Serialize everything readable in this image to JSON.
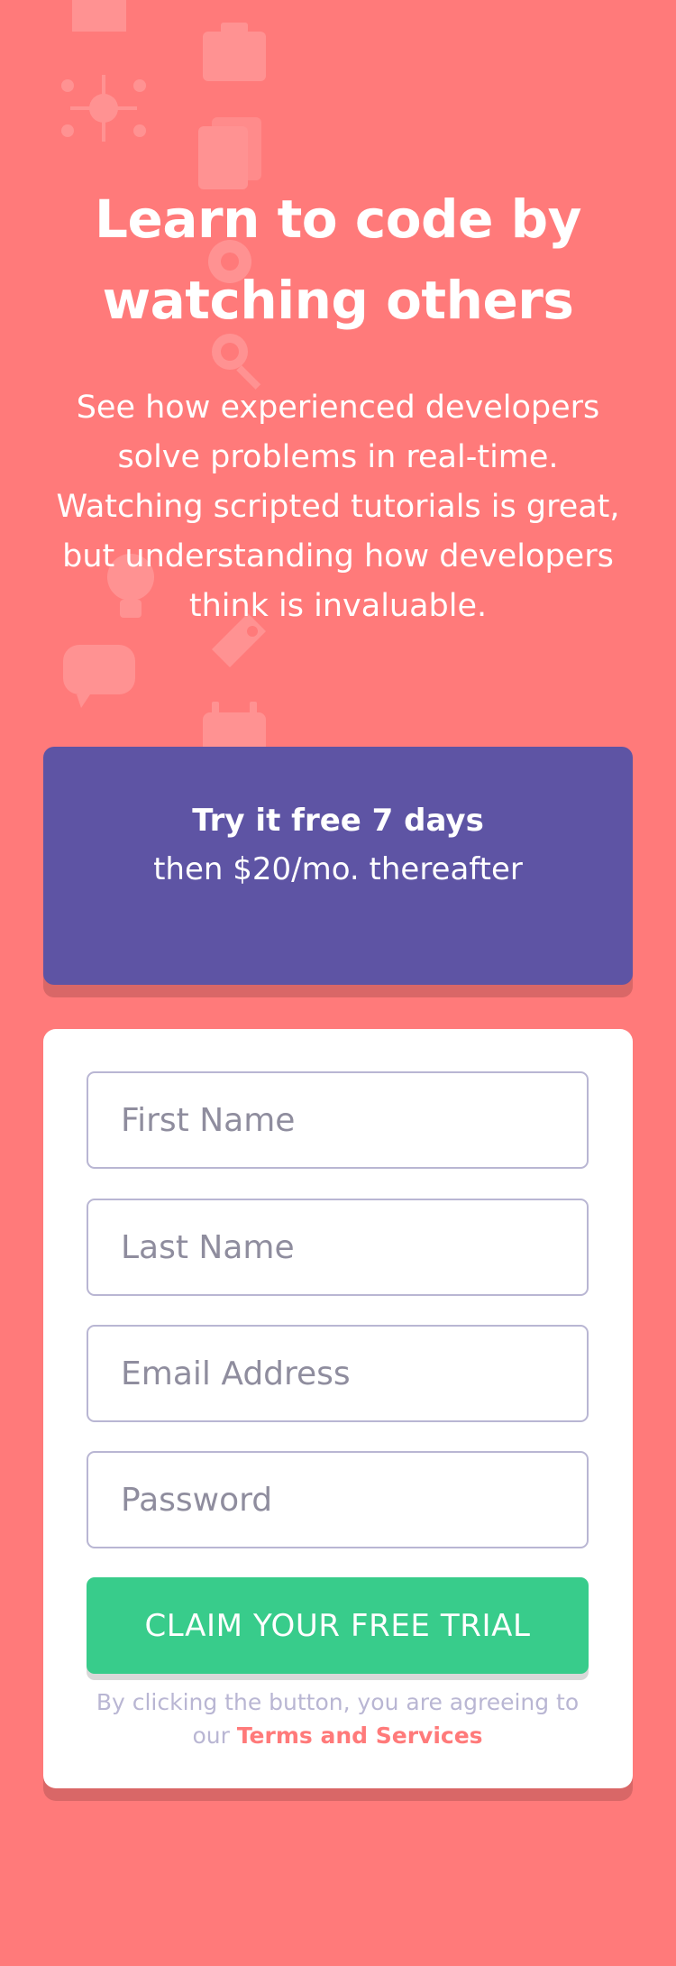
{
  "page": {
    "background_color": "#FF7A7A"
  },
  "hero": {
    "title": "Learn to code by watching others",
    "subtitle": "See how experienced developers solve problems in real-time. Watching scripted tutorials is great, but understanding how developers think is invaluable."
  },
  "offer": {
    "bold_text": "Try it free 7 days",
    "rest_text": "then $20/mo. thereafter",
    "background_color": "#5E54A4"
  },
  "form": {
    "first_name": {
      "placeholder": "First Name",
      "value": ""
    },
    "last_name": {
      "placeholder": "Last Name",
      "value": ""
    },
    "email": {
      "placeholder": "Email Address",
      "value": ""
    },
    "password": {
      "placeholder": "Password",
      "value": ""
    },
    "submit_label": "CLAIM YOUR FREE TRIAL",
    "submit_color": "#38CC8B",
    "terms_prefix": "By clicking the button, you are agreeing to our",
    "terms_link": "Terms and Services"
  },
  "icons": [
    "home-icon",
    "network-icon",
    "toolbox-icon",
    "document-stack-icon",
    "gear-icon",
    "magnifier-icon",
    "lightbulb-icon",
    "chat-bubble-icon",
    "calendar-icon",
    "rocket-icon"
  ]
}
